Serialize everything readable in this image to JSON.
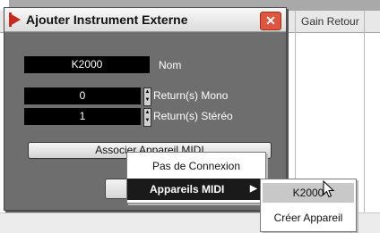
{
  "background_table": {
    "column_header": "Gain Retour"
  },
  "dialog": {
    "title": "Ajouter Instrument Externe",
    "close_glyph": "✕",
    "name_field": {
      "value": "K2000",
      "label": "Nom"
    },
    "mono_field": {
      "value": "0",
      "label": "Return(s) Mono"
    },
    "stereo_field": {
      "value": "1",
      "label": "Return(s) Stéréo"
    },
    "associate_button": "Associer Appareil MIDI"
  },
  "context_menu": {
    "items": [
      {
        "label": "Pas de Connexion"
      },
      {
        "label": "Appareils MIDI",
        "arrow": "▶"
      }
    ]
  },
  "submenu": {
    "items": [
      {
        "label": "K2000"
      },
      {
        "label": "Créer Appareil"
      }
    ]
  },
  "icons": {
    "title_icon": "steinberg-logo-icon",
    "cursor": "mouse-pointer-icon",
    "spin_up": "▲",
    "spin_down": "▼"
  }
}
